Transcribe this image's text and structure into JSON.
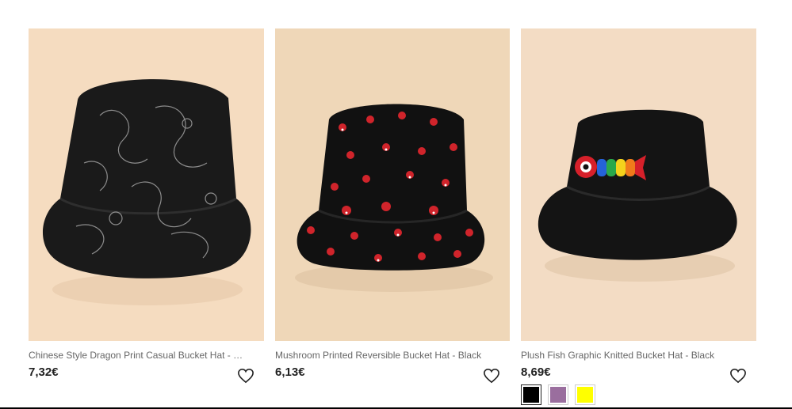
{
  "products": [
    {
      "title": "Chinese Style Dragon Print Casual Bucket Hat - Bla...",
      "price": "7,32€",
      "bg": "#f5dcc0"
    },
    {
      "title": "Mushroom Printed Reversible Bucket Hat - Black",
      "price": "6,13€",
      "bg": "#efd7b8"
    },
    {
      "title": "Plush Fish Graphic Knitted Bucket Hat - Black",
      "price": "8,69€",
      "bg": "#f3dcc4"
    }
  ],
  "swatches": [
    {
      "name": "Black",
      "color": "#000000"
    },
    {
      "name": "Purple",
      "color": "#9a6e9e"
    },
    {
      "name": "Yellow",
      "color": "#ffff00"
    }
  ],
  "icons": {
    "wishlist": "heart-outline-icon"
  }
}
